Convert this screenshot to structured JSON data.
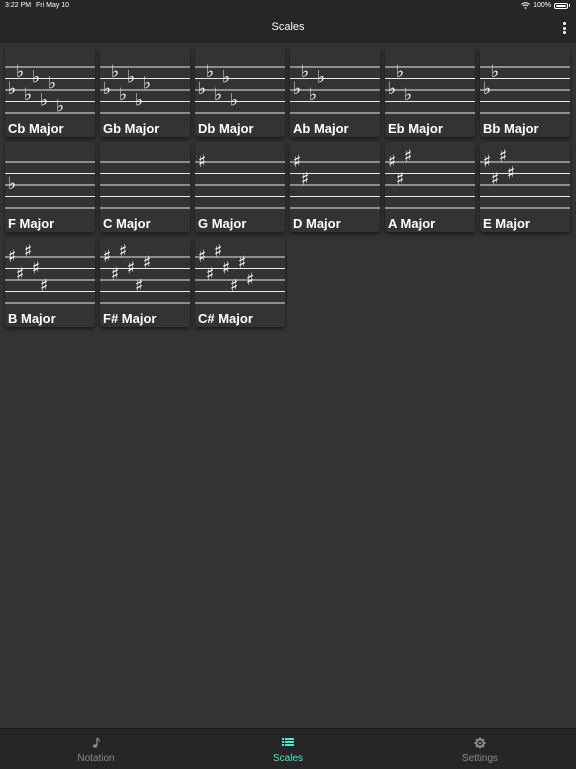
{
  "status_bar": {
    "time": "3:22 PM",
    "date": "Fri May 10",
    "battery": "100%"
  },
  "header": {
    "title": "Scales"
  },
  "scales": [
    {
      "label": "Cb Major",
      "accidental": "flat",
      "count": 7
    },
    {
      "label": "Gb Major",
      "accidental": "flat",
      "count": 6
    },
    {
      "label": "Db Major",
      "accidental": "flat",
      "count": 5
    },
    {
      "label": "Ab Major",
      "accidental": "flat",
      "count": 4
    },
    {
      "label": "Eb Major",
      "accidental": "flat",
      "count": 3
    },
    {
      "label": "Bb Major",
      "accidental": "flat",
      "count": 2
    },
    {
      "label": "F Major",
      "accidental": "flat",
      "count": 1
    },
    {
      "label": "C Major",
      "accidental": "none",
      "count": 0
    },
    {
      "label": "G Major",
      "accidental": "sharp",
      "count": 1
    },
    {
      "label": "D Major",
      "accidental": "sharp",
      "count": 2
    },
    {
      "label": "A Major",
      "accidental": "sharp",
      "count": 3
    },
    {
      "label": "E Major",
      "accidental": "sharp",
      "count": 4
    },
    {
      "label": "B Major",
      "accidental": "sharp",
      "count": 5
    },
    {
      "label": "F# Major",
      "accidental": "sharp",
      "count": 6
    },
    {
      "label": "C# Major",
      "accidental": "sharp",
      "count": 7
    }
  ],
  "tabs": [
    {
      "label": "Notation",
      "icon": "music-note-icon",
      "active": false
    },
    {
      "label": "Scales",
      "icon": "list-icon",
      "active": true
    },
    {
      "label": "Settings",
      "icon": "gear-icon",
      "active": false
    }
  ],
  "colors": {
    "accent": "#5ee0c8",
    "background": "#333333",
    "bar": "#262626",
    "inactive": "#8a8a8a"
  }
}
